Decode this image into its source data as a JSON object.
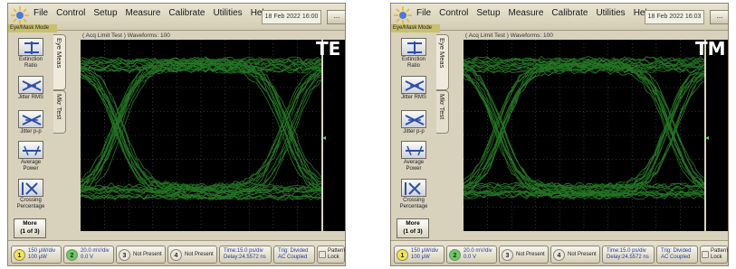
{
  "colors": {
    "trace": "#3fcf3f",
    "grid": "#5a5a5a",
    "plot_bg": "#000000",
    "frame": "#d8d2bd"
  },
  "screens": [
    {
      "label": "TE",
      "menu": [
        "File",
        "Control",
        "Setup",
        "Measure",
        "Calibrate",
        "Utilities",
        "Help"
      ],
      "datetime": "18 Feb 2022  16:00",
      "more_button": "...",
      "mode_label": "Eye/Mask Mode",
      "waveform_header": "( Acq Limit Test ) Waveforms: 100",
      "tabs": [
        "Eye Meas",
        "Mkr  Test"
      ],
      "measurements": [
        {
          "icon": "extinction-ratio-icon",
          "label": "Extinction Ratio"
        },
        {
          "icon": "jitter-rms-icon",
          "label": "Jitter RMS"
        },
        {
          "icon": "jitter-pp-icon",
          "label": "Jitter p-p"
        },
        {
          "icon": "average-power-icon",
          "label": "Average Power"
        },
        {
          "icon": "crossing-percentage-icon",
          "label": "Crossing Percentage"
        }
      ],
      "more_panel": {
        "line1": "More",
        "line2": "(1 of 3)"
      },
      "status": {
        "ch1": {
          "num": "1",
          "line1": "150 μW/div",
          "line2": "100 μW"
        },
        "ch2": {
          "num": "2",
          "line1": "20.0 mV/div",
          "line2": "0.0 V"
        },
        "ch3": {
          "num": "3",
          "line1": "Not Present"
        },
        "ch4": {
          "num": "4",
          "line1": "Not Present"
        },
        "time": {
          "line1": "Time:15.0 ps/div",
          "line2": "Delay:24.5572 ns"
        },
        "trig": {
          "line1": "Trig: Divided",
          "line2": "AC Coupled"
        },
        "pattern": {
          "line1": "Pattern",
          "line2": "Lock"
        }
      }
    },
    {
      "label": "TM",
      "menu": [
        "File",
        "Control",
        "Setup",
        "Measure",
        "Calibrate",
        "Utilities",
        "Help"
      ],
      "datetime": "18 Feb 2022  16:03",
      "more_button": "...",
      "mode_label": "Eye/Mask Mode",
      "waveform_header": "( Acq Limit Test ) Waveforms: 100",
      "tabs": [
        "Eye Meas",
        "Mkr  Test"
      ],
      "measurements": [
        {
          "icon": "extinction-ratio-icon",
          "label": "Extinction Ratio"
        },
        {
          "icon": "jitter-rms-icon",
          "label": "Jitter RMS"
        },
        {
          "icon": "jitter-pp-icon",
          "label": "Jitter p-p"
        },
        {
          "icon": "average-power-icon",
          "label": "Average Power"
        },
        {
          "icon": "crossing-percentage-icon",
          "label": "Crossing Percentage"
        }
      ],
      "more_panel": {
        "line1": "More",
        "line2": "(1 of 3)"
      },
      "status": {
        "ch1": {
          "num": "1",
          "line1": "150 μW/div",
          "line2": "100 μW"
        },
        "ch2": {
          "num": "2",
          "line1": "20.0 mV/div",
          "line2": "0.0 V"
        },
        "ch3": {
          "num": "3",
          "line1": "Not Present"
        },
        "ch4": {
          "num": "4",
          "line1": "Not Present"
        },
        "time": {
          "line1": "Time:15.0 ps/div",
          "line2": "Delay:24.5572 ns"
        },
        "trig": {
          "line1": "Trig: Divided",
          "line2": "AC Coupled"
        },
        "pattern": {
          "line1": "Pattern",
          "line2": "Lock"
        }
      }
    }
  ]
}
